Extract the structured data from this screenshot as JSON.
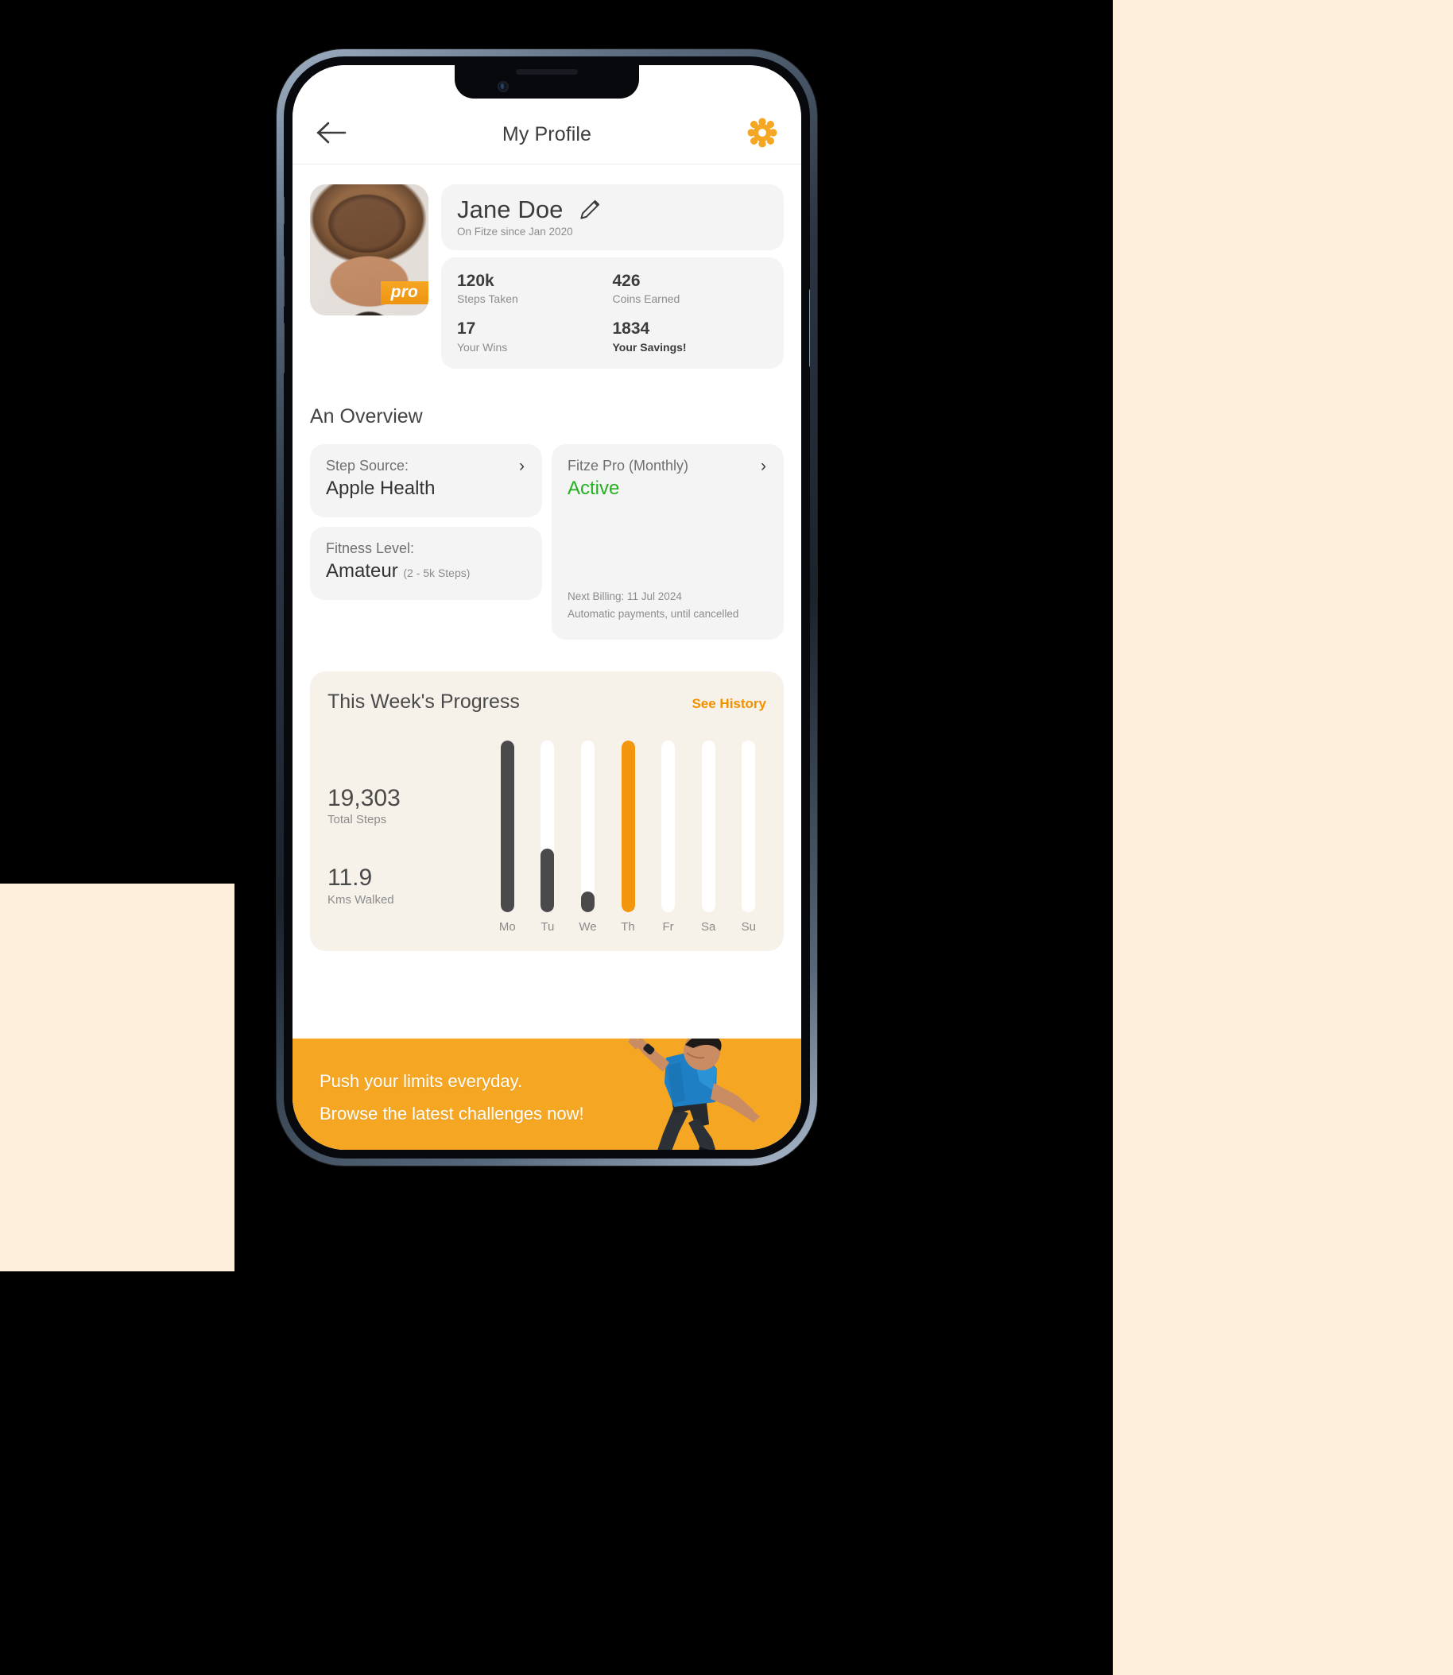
{
  "header": {
    "title": "My Profile",
    "back_icon": "arrow-left-icon",
    "settings_icon": "gear-icon"
  },
  "profile": {
    "avatar_badge": "pro",
    "name": "Jane Doe",
    "member_since": "On Fitze since Jan 2020",
    "edit_icon": "pencil-icon",
    "stats": [
      {
        "value": "120k",
        "label": "Steps Taken",
        "emphasis": false
      },
      {
        "value": "426",
        "label": "Coins Earned",
        "emphasis": false
      },
      {
        "value": "17",
        "label": "Your Wins",
        "emphasis": false
      },
      {
        "value": "1834",
        "label": "Your Savings!",
        "emphasis": true
      }
    ]
  },
  "overview": {
    "title": "An Overview",
    "step_source": {
      "label": "Step Source:",
      "value": "Apple Health",
      "chevron": "chevron-right-icon"
    },
    "fitness_level": {
      "label": "Fitness Level:",
      "value": "Amateur",
      "value_sub": "(2 - 5k Steps)"
    },
    "subscription": {
      "label": "Fitze Pro (Monthly)",
      "status": "Active",
      "status_color": "#22B01F",
      "chevron": "chevron-right-icon",
      "next_billing": "Next Billing: 11 Jul 2024",
      "payment_note": "Automatic payments, until cancelled"
    }
  },
  "progress": {
    "title": "This Week's Progress",
    "history_link": "See History",
    "total_steps_value": "19,303",
    "total_steps_label": "Total Steps",
    "kms_value": "11.9",
    "kms_label": "Kms Walked"
  },
  "chart_data": {
    "type": "bar",
    "title": "This Week's Progress",
    "categories": [
      "Mo",
      "Tu",
      "We",
      "Th",
      "Fr",
      "Sa",
      "Su"
    ],
    "values": [
      100,
      37,
      12,
      100,
      0,
      0,
      0
    ],
    "unit": "percent of daily goal",
    "bar_colors": [
      "#4A4A4A",
      "#4A4A4A",
      "#4A4A4A",
      "#F2960D",
      "#FFFFFF",
      "#FFFFFF",
      "#FFFFFF"
    ],
    "track_color": "#FFFFFF",
    "highlight_index": 3,
    "highlight_label": "Th",
    "xlabel": "",
    "ylabel": "",
    "ylim": [
      0,
      100
    ],
    "grid": false,
    "legend": false
  },
  "banner": {
    "line1": "Push your limits everyday.",
    "line2": "Browse the latest challenges now!",
    "bg_color": "#F5A623"
  },
  "theme": {
    "accent_orange": "#F5A623",
    "link_orange": "#F29100",
    "dark_bar": "#4A4A4A",
    "active_green": "#22B01F",
    "card_grey": "#F4F4F4",
    "progress_card": "#F6F2EA",
    "page_cream": "#FDEEDB"
  }
}
